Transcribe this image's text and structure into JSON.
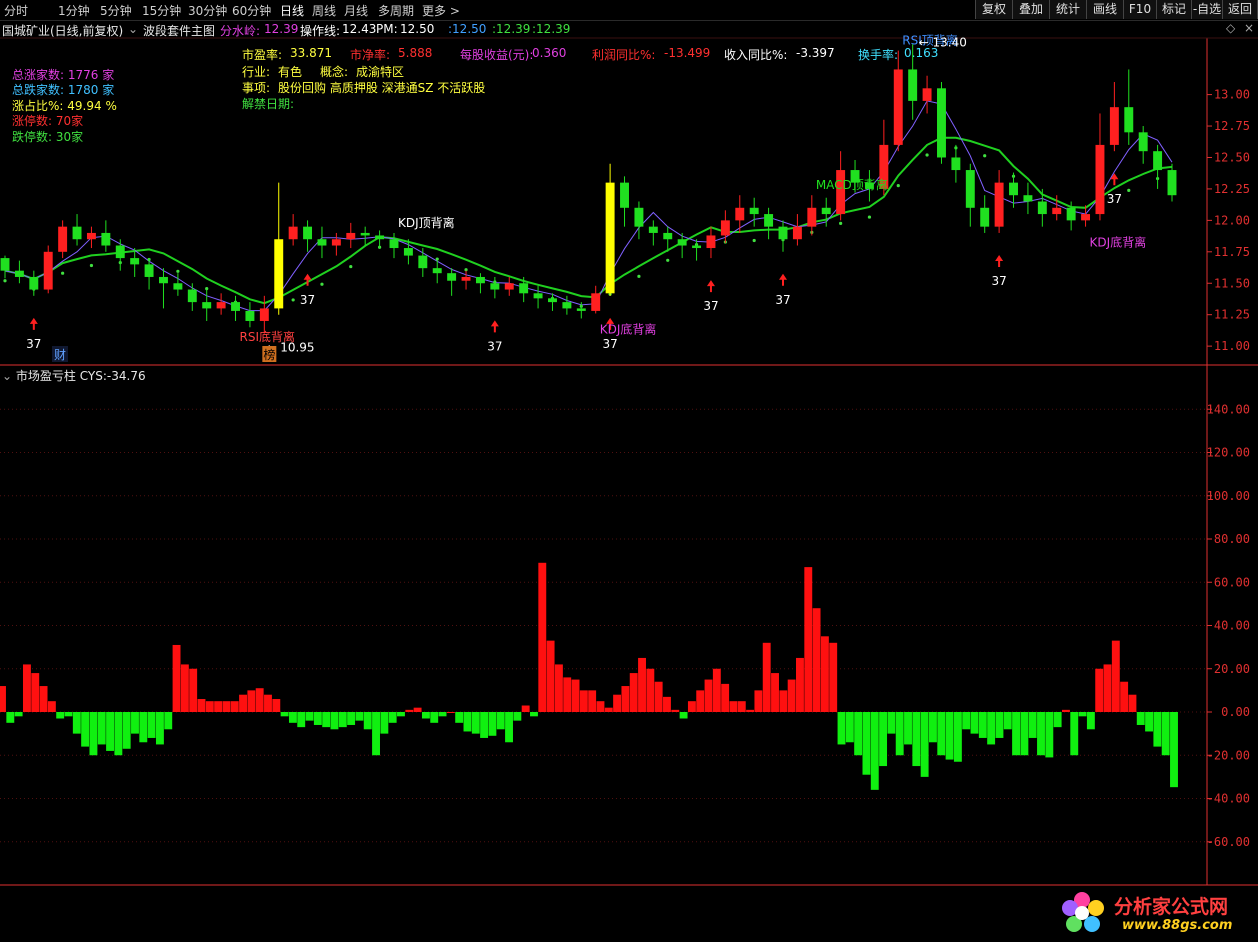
{
  "toolbar": {
    "periods": [
      "分时",
      "1分钟",
      "5分钟",
      "15分钟",
      "30分钟",
      "60分钟",
      "日线",
      "周线",
      "月线",
      "多周期",
      "更多 >"
    ],
    "active_period": "日线",
    "right_buttons": [
      "复权",
      "叠加",
      "统计",
      "画线",
      "F10",
      "标记",
      "-自选",
      "返回"
    ]
  },
  "title": {
    "stock": "国城矿业(日线,前复权)",
    "indicator": "波段套件主图",
    "fenshuiling_label": "分水岭:",
    "fenshuiling_value": "12.39",
    "caozuo_label": "操作线:",
    "caozuo_value": "12.43",
    "pm_label": "PM:",
    "pm_value": "12.50",
    "v1": ":12.50",
    "v2": ":12.39",
    "v3": ":12.39"
  },
  "market": {
    "rise_label": "总涨家数:",
    "rise_value": "1776 家",
    "fall_label": "总跌家数:",
    "fall_value": "1780 家",
    "ratio_label": "涨占比%:",
    "ratio_value": "49.94 %",
    "limitup_label": "涨停数:",
    "limitup_value": "70家",
    "limitdown_label": "跌停数:",
    "limitdown_value": "30家"
  },
  "fundamentals": {
    "pe_label": "市盈率:",
    "pe_value": "33.871",
    "pb_label": "市净率:",
    "pb_value": "5.888",
    "eps_label": "每股收益(元):",
    "eps_value": "0.360",
    "profit_label": "利润同比%:",
    "profit_value": "-13.499",
    "revenue_label": "收入同比%:",
    "revenue_value": "-3.397",
    "turnover_label": "换手率:",
    "turnover_value": "0.163",
    "industry_label": "行业:",
    "industry_value": "有色",
    "concept_label": "概念:",
    "concept_value": "成渝特区",
    "events_label": "事项:",
    "events_value": "股份回购 高质押股 深港通SZ 不活跃股",
    "unlock_label": "解禁日期:"
  },
  "lower_panel": {
    "name": "市场盈亏柱",
    "cys_label": "CYS:",
    "cys_value": "-34.76"
  },
  "watermark": {
    "text": "分析家公式网",
    "url": "www.88gs.com"
  },
  "colors": {
    "up": "#ff2020",
    "down": "#20e020",
    "yellow": "#ffff00",
    "ma": "#20d020",
    "axis": "#e03030"
  },
  "chart_data": [
    {
      "type": "candlestick",
      "y_ticks": [
        "13.00",
        "12.75",
        "12.50",
        "12.25",
        "12.00",
        "11.75",
        "11.50",
        "11.25",
        "11.00"
      ],
      "ylim": [
        10.85,
        13.45
      ],
      "high_label": "13.40",
      "low_label": "10.95",
      "badge_cai": "财",
      "badge_bang": "榜",
      "ohlc": [
        [
          11.7,
          11.6,
          11.72,
          11.54
        ],
        [
          11.6,
          11.55,
          11.68,
          11.5
        ],
        [
          11.55,
          11.45,
          11.6,
          11.4
        ],
        [
          11.45,
          11.75,
          11.8,
          11.42
        ],
        [
          11.75,
          11.95,
          12.0,
          11.7
        ],
        [
          11.95,
          11.85,
          12.05,
          11.8
        ],
        [
          11.85,
          11.9,
          11.95,
          11.78
        ],
        [
          11.9,
          11.8,
          12.0,
          11.75
        ],
        [
          11.8,
          11.7,
          11.85,
          11.6
        ],
        [
          11.7,
          11.65,
          11.78,
          11.55
        ],
        [
          11.65,
          11.55,
          11.7,
          11.45
        ],
        [
          11.55,
          11.5,
          11.62,
          11.3
        ],
        [
          11.5,
          11.45,
          11.58,
          11.4
        ],
        [
          11.45,
          11.35,
          11.5,
          11.28
        ],
        [
          11.35,
          11.3,
          11.45,
          11.2
        ],
        [
          11.3,
          11.35,
          11.42,
          11.25
        ],
        [
          11.35,
          11.28,
          11.4,
          11.2
        ],
        [
          11.28,
          11.2,
          11.35,
          11.15
        ],
        [
          11.2,
          11.3,
          11.4,
          11.1
        ],
        [
          11.3,
          11.85,
          12.3,
          11.25
        ],
        [
          11.85,
          11.95,
          12.05,
          11.8
        ],
        [
          11.95,
          11.85,
          12.0,
          11.75
        ],
        [
          11.85,
          11.8,
          11.95,
          11.7
        ],
        [
          11.8,
          11.85,
          11.9,
          11.72
        ],
        [
          11.85,
          11.9,
          11.98,
          11.78
        ],
        [
          11.9,
          11.88,
          11.95,
          11.8
        ],
        [
          11.88,
          11.85,
          11.92,
          11.78
        ],
        [
          11.85,
          11.78,
          11.9,
          11.7
        ],
        [
          11.78,
          11.72,
          11.85,
          11.65
        ],
        [
          11.72,
          11.62,
          11.78,
          11.55
        ],
        [
          11.62,
          11.58,
          11.68,
          11.5
        ],
        [
          11.58,
          11.52,
          11.62,
          11.4
        ],
        [
          11.52,
          11.55,
          11.6,
          11.45
        ],
        [
          11.55,
          11.5,
          11.58,
          11.42
        ],
        [
          11.5,
          11.45,
          11.55,
          11.38
        ],
        [
          11.45,
          11.5,
          11.55,
          11.4
        ],
        [
          11.5,
          11.42,
          11.55,
          11.35
        ],
        [
          11.42,
          11.38,
          11.48,
          11.3
        ],
        [
          11.38,
          11.35,
          11.42,
          11.28
        ],
        [
          11.35,
          11.3,
          11.4,
          11.25
        ],
        [
          11.3,
          11.28,
          11.35,
          11.22
        ],
        [
          11.28,
          11.42,
          11.48,
          11.26
        ],
        [
          11.42,
          12.3,
          12.45,
          11.4
        ],
        [
          12.3,
          12.1,
          12.35,
          11.95
        ],
        [
          12.1,
          11.95,
          12.15,
          11.85
        ],
        [
          11.95,
          11.9,
          12.0,
          11.8
        ],
        [
          11.9,
          11.85,
          11.95,
          11.75
        ],
        [
          11.85,
          11.8,
          11.9,
          11.7
        ],
        [
          11.8,
          11.78,
          11.85,
          11.68
        ],
        [
          11.78,
          11.88,
          11.95,
          11.7
        ],
        [
          11.88,
          12.0,
          12.08,
          11.82
        ],
        [
          12.0,
          12.1,
          12.2,
          11.9
        ],
        [
          12.1,
          12.05,
          12.18,
          11.95
        ],
        [
          12.05,
          11.95,
          12.1,
          11.85
        ],
        [
          11.95,
          11.85,
          12.0,
          11.75
        ],
        [
          11.85,
          11.95,
          12.05,
          11.8
        ],
        [
          11.95,
          12.1,
          12.2,
          11.88
        ],
        [
          12.1,
          12.05,
          12.18,
          11.95
        ],
        [
          12.05,
          12.4,
          12.55,
          12.0
        ],
        [
          12.4,
          12.3,
          12.48,
          12.22
        ],
        [
          12.3,
          12.25,
          12.4,
          12.15
        ],
        [
          12.25,
          12.6,
          12.8,
          12.2
        ],
        [
          12.6,
          13.2,
          13.35,
          12.55
        ],
        [
          13.2,
          12.95,
          13.4,
          12.8
        ],
        [
          12.95,
          13.05,
          13.15,
          12.85
        ],
        [
          13.05,
          12.5,
          13.1,
          12.45
        ],
        [
          12.5,
          12.4,
          12.6,
          12.3
        ],
        [
          12.4,
          12.1,
          12.45,
          11.95
        ],
        [
          12.1,
          11.95,
          12.2,
          11.9
        ],
        [
          11.95,
          12.3,
          12.4,
          11.9
        ],
        [
          12.3,
          12.2,
          12.38,
          12.1
        ],
        [
          12.2,
          12.15,
          12.3,
          12.05
        ],
        [
          12.15,
          12.05,
          12.25,
          11.95
        ],
        [
          12.05,
          12.1,
          12.2,
          12.0
        ],
        [
          12.1,
          12.0,
          12.15,
          11.92
        ],
        [
          12.0,
          12.05,
          12.12,
          11.95
        ],
        [
          12.05,
          12.6,
          12.85,
          12.0
        ],
        [
          12.6,
          12.9,
          13.1,
          12.55
        ],
        [
          12.9,
          12.7,
          13.2,
          12.6
        ],
        [
          12.7,
          12.55,
          12.75,
          12.45
        ],
        [
          12.55,
          12.4,
          12.6,
          12.25
        ],
        [
          12.4,
          12.2,
          12.45,
          12.15
        ]
      ],
      "markers": [
        {
          "index": 2,
          "text": "37"
        },
        {
          "index": 21,
          "text": "37"
        },
        {
          "index": 34,
          "text": "37"
        },
        {
          "index": 42,
          "text": "37"
        },
        {
          "index": 49,
          "text": "37"
        },
        {
          "index": 54,
          "text": "37"
        },
        {
          "index": 69,
          "text": "37"
        },
        {
          "index": 77,
          "text": "37"
        }
      ],
      "signals": [
        {
          "index": 16,
          "text": "RSI底背离",
          "color": "#ff4040"
        },
        {
          "index": 27,
          "text": "KDJ顶背离",
          "color": "#ffffff"
        },
        {
          "index": 41,
          "text": "KDJ底背离",
          "color": "#e040e0"
        },
        {
          "index": 56,
          "text": "MACD顶背离",
          "color": "#20e020"
        },
        {
          "index": 62,
          "text": "RSI顶背离",
          "color": "#4090ff"
        },
        {
          "index": 75,
          "text": "KDJ底背离",
          "color": "#e040e0"
        }
      ]
    },
    {
      "type": "bar",
      "series_name": "市场盈亏柱",
      "y_ticks": [
        "140.00",
        "120.00",
        "100.00",
        "80.00",
        "60.00",
        "40.00",
        "20.00",
        "0.00",
        "-20.00",
        "-40.00",
        "-60.00"
      ],
      "ylim": [
        -80,
        160
      ],
      "values": [
        12,
        -5,
        -2,
        22,
        18,
        12,
        5,
        -3,
        -2,
        -10,
        -16,
        -20,
        -15,
        -18,
        -20,
        -17,
        -10,
        -14,
        -12,
        -15,
        -8,
        31,
        22,
        20,
        6,
        5,
        5,
        5,
        5,
        8,
        10,
        11,
        8,
        6,
        -2,
        -5,
        -7,
        -4,
        -6,
        -7,
        -8,
        -7,
        -6,
        -4,
        -8,
        -20,
        -10,
        -5,
        -2,
        1,
        2,
        -3,
        -5,
        -2,
        0,
        -5,
        -9,
        -10,
        -12,
        -11,
        -8,
        -14,
        -4,
        3,
        -2,
        69,
        33,
        22,
        16,
        15,
        10,
        10,
        5,
        2,
        8,
        12,
        18,
        25,
        20,
        14,
        7,
        1,
        -3,
        5,
        10,
        15,
        20,
        13,
        5,
        5,
        1,
        10,
        32,
        18,
        10,
        15,
        25,
        67,
        48,
        35,
        32,
        -15,
        -14,
        -20,
        -29,
        -36,
        -25,
        -10,
        -20,
        -15,
        -25,
        -30,
        -14,
        -20,
        -22,
        -23,
        -8,
        -10,
        -12,
        -15,
        -12,
        -8,
        -20,
        -20,
        -12,
        -20,
        -21,
        -7,
        1,
        -20,
        -2,
        -8,
        20,
        22,
        33,
        14,
        8,
        -6,
        -9,
        -16,
        -20,
        -34.76
      ]
    }
  ]
}
